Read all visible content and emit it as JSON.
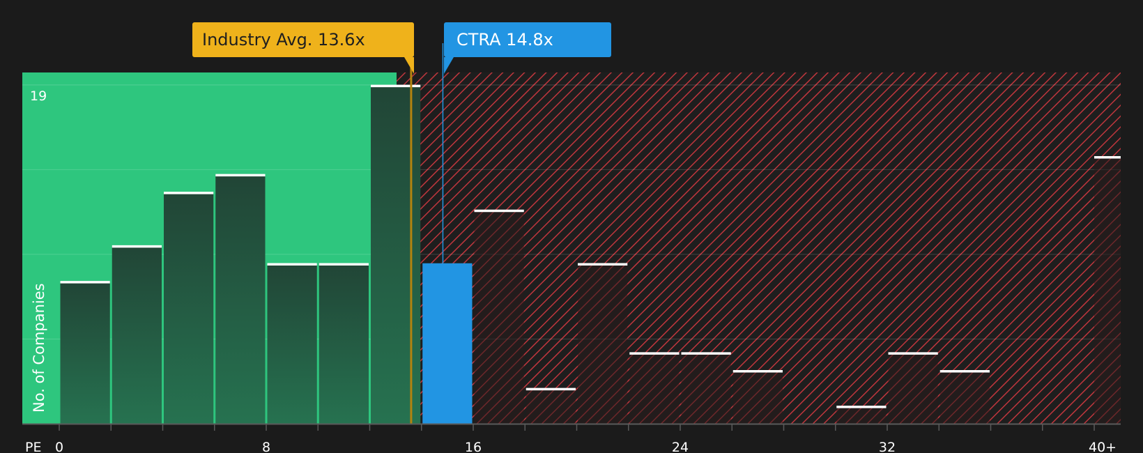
{
  "colors": {
    "background": "#1b1b1b",
    "undervalued_zone": "#2ec67e",
    "overvalued_hatch": "#c0363d",
    "bar_fill_top": "#214536",
    "bar_fill_bottom": "#267250",
    "company_bar": "#2295e3",
    "industry_marker": "#efb21b",
    "cap_line": "#ffffff",
    "text": "#ffffff"
  },
  "callouts": {
    "industry": {
      "label": "Industry Avg. 13.6x",
      "value": 13.6
    },
    "company": {
      "label": "CTRA 14.8x",
      "ticker": "CTRA",
      "value": 14.8
    }
  },
  "chart_data": {
    "type": "bar",
    "title": "",
    "xlabel": "PE",
    "ylabel": "No. of Companies",
    "bin_width": 2,
    "xlim": [
      0,
      41
    ],
    "ylim": [
      0,
      19.7
    ],
    "x_ticks": [
      {
        "value": 0,
        "label": "0"
      },
      {
        "value": 8,
        "label": "8"
      },
      {
        "value": 16,
        "label": "16"
      },
      {
        "value": 24,
        "label": "24"
      },
      {
        "value": 32,
        "label": "32"
      },
      {
        "value": 40,
        "label": "40+"
      }
    ],
    "y_max_label": "19",
    "y_gridlines": [
      4.75,
      9.5,
      14.25,
      19
    ],
    "undervalued_below": 13.6,
    "highlight_bin_start": 14,
    "bins": [
      {
        "start": 0,
        "count": 8
      },
      {
        "start": 2,
        "count": 10
      },
      {
        "start": 4,
        "count": 13
      },
      {
        "start": 6,
        "count": 14
      },
      {
        "start": 8,
        "count": 9
      },
      {
        "start": 10,
        "count": 9
      },
      {
        "start": 12,
        "count": 19
      },
      {
        "start": 14,
        "count": 9
      },
      {
        "start": 16,
        "count": 12
      },
      {
        "start": 18,
        "count": 2
      },
      {
        "start": 20,
        "count": 9
      },
      {
        "start": 22,
        "count": 4
      },
      {
        "start": 24,
        "count": 4
      },
      {
        "start": 26,
        "count": 3
      },
      {
        "start": 28,
        "count": 0
      },
      {
        "start": 30,
        "count": 1
      },
      {
        "start": 32,
        "count": 4
      },
      {
        "start": 34,
        "count": 3
      },
      {
        "start": 36,
        "count": 0
      },
      {
        "start": 38,
        "count": 0
      },
      {
        "start": 40,
        "count": 15
      }
    ]
  }
}
